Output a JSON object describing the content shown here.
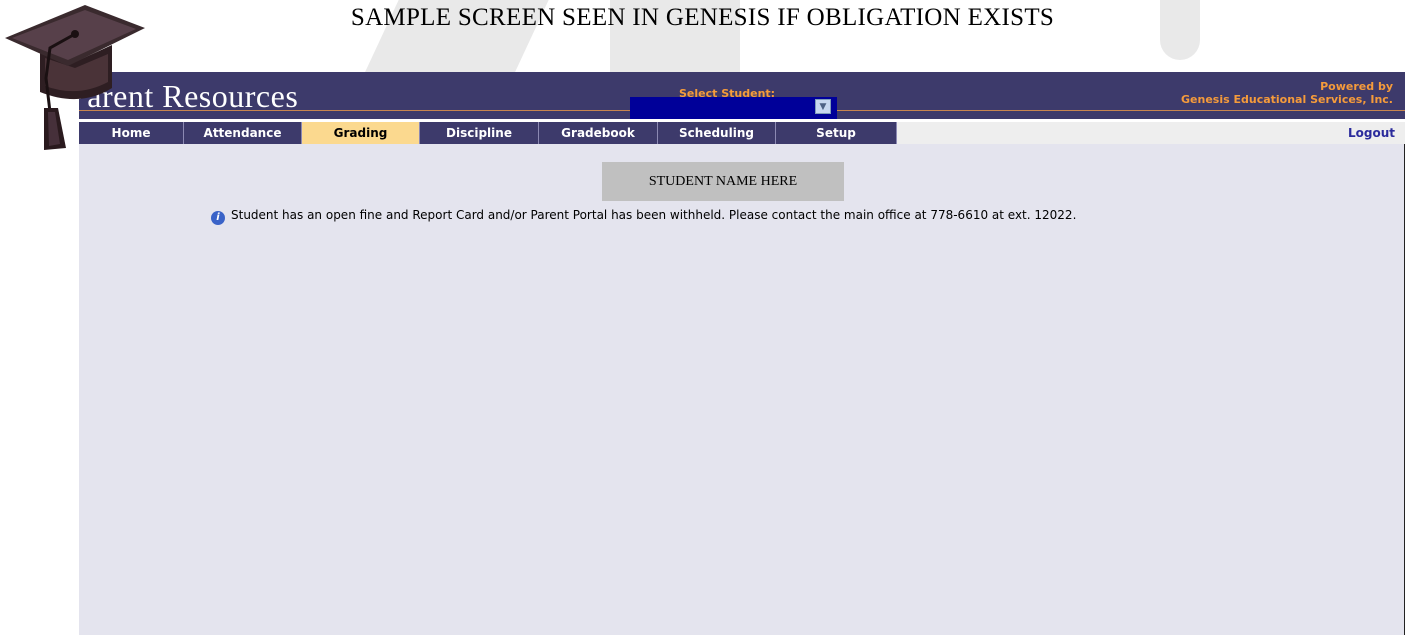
{
  "page": {
    "title": "SAMPLE SCREEN SEEN IN GENESIS IF OBLIGATION EXISTS"
  },
  "header": {
    "brand": "Parent Resources",
    "select_student_label": "Select Student:",
    "powered_line1": "Powered by",
    "powered_line2": "Genesis Educational Services, Inc."
  },
  "nav": {
    "tabs": [
      {
        "label": "Home"
      },
      {
        "label": "Attendance"
      },
      {
        "label": "Grading"
      },
      {
        "label": "Discipline"
      },
      {
        "label": "Gradebook"
      },
      {
        "label": "Scheduling"
      },
      {
        "label": "Setup"
      }
    ],
    "active_tab": "Grading",
    "logout": "Logout"
  },
  "main": {
    "student_name": "STUDENT NAME HERE",
    "notice": "Student has an open fine and Report Card and/or Parent Portal has been withheld. Please contact the main office at 778-6610 at ext. 12022."
  },
  "colors": {
    "header_bg": "#3d3a6b",
    "accent_orange": "#f59b3b",
    "active_tab_bg": "#fbd98f",
    "content_bg": "#e4e4ee",
    "select_bg": "#000099"
  },
  "icons": {
    "logo": "graduation-cap-icon",
    "notice": "info-icon",
    "select_arrow": "chevron-down-icon"
  }
}
